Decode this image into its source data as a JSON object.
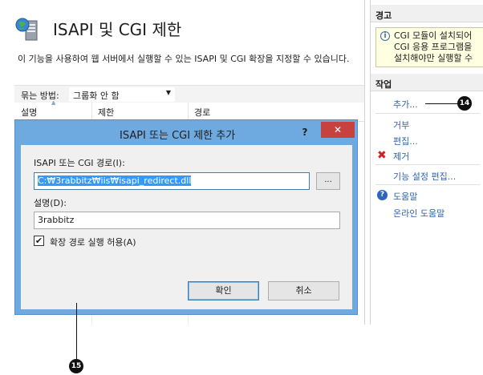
{
  "main": {
    "title": "ISAPI 및 CGI 제한",
    "description": "이 기능을 사용하여 웹 서버에서 실행할 수 있는 ISAPI 및 CGI 확장을 지정할 수 있습니다.",
    "group_by_label": "묶는 방법:",
    "group_by_value": "그룹화 안 함",
    "columns": [
      "설명",
      "제한",
      "경로"
    ]
  },
  "actions_pane": {
    "alert_header": "경고",
    "alert_lines": [
      "CGI 모듈이 설치되어",
      "CGI 응용 프로그램을",
      "설치해야만 실행할 수"
    ],
    "actions_header": "작업",
    "items": {
      "add": "추가...",
      "deny": "거부",
      "edit": "편집...",
      "remove": "제거",
      "edit_settings": "기능 설정 편집...",
      "help": "도움말",
      "online_help": "온라인 도움말"
    }
  },
  "dialog": {
    "title": "ISAPI 또는 CGI 제한  추가",
    "help_glyph": "?",
    "close_glyph": "✕",
    "path_label": "ISAPI 또는 CGI 경로(I):",
    "path_value": "C:₩3rabbitz₩iis₩isapi_redirect.dll",
    "browse_label": "...",
    "desc_label": "설명(D):",
    "desc_value": "3rabbitz",
    "allow_ext_label": "확장 경로 실행 허용(A)",
    "allow_ext_checked": true,
    "ok_label": "확인",
    "cancel_label": "취소"
  },
  "callouts": {
    "c14": "14",
    "c15": "15"
  },
  "colors": {
    "link": "#2f63a9",
    "dialog_frame": "#6ea9e0",
    "close_button": "#c7423f",
    "selection": "#3399ff",
    "alert_bg": "#ffffe1"
  }
}
